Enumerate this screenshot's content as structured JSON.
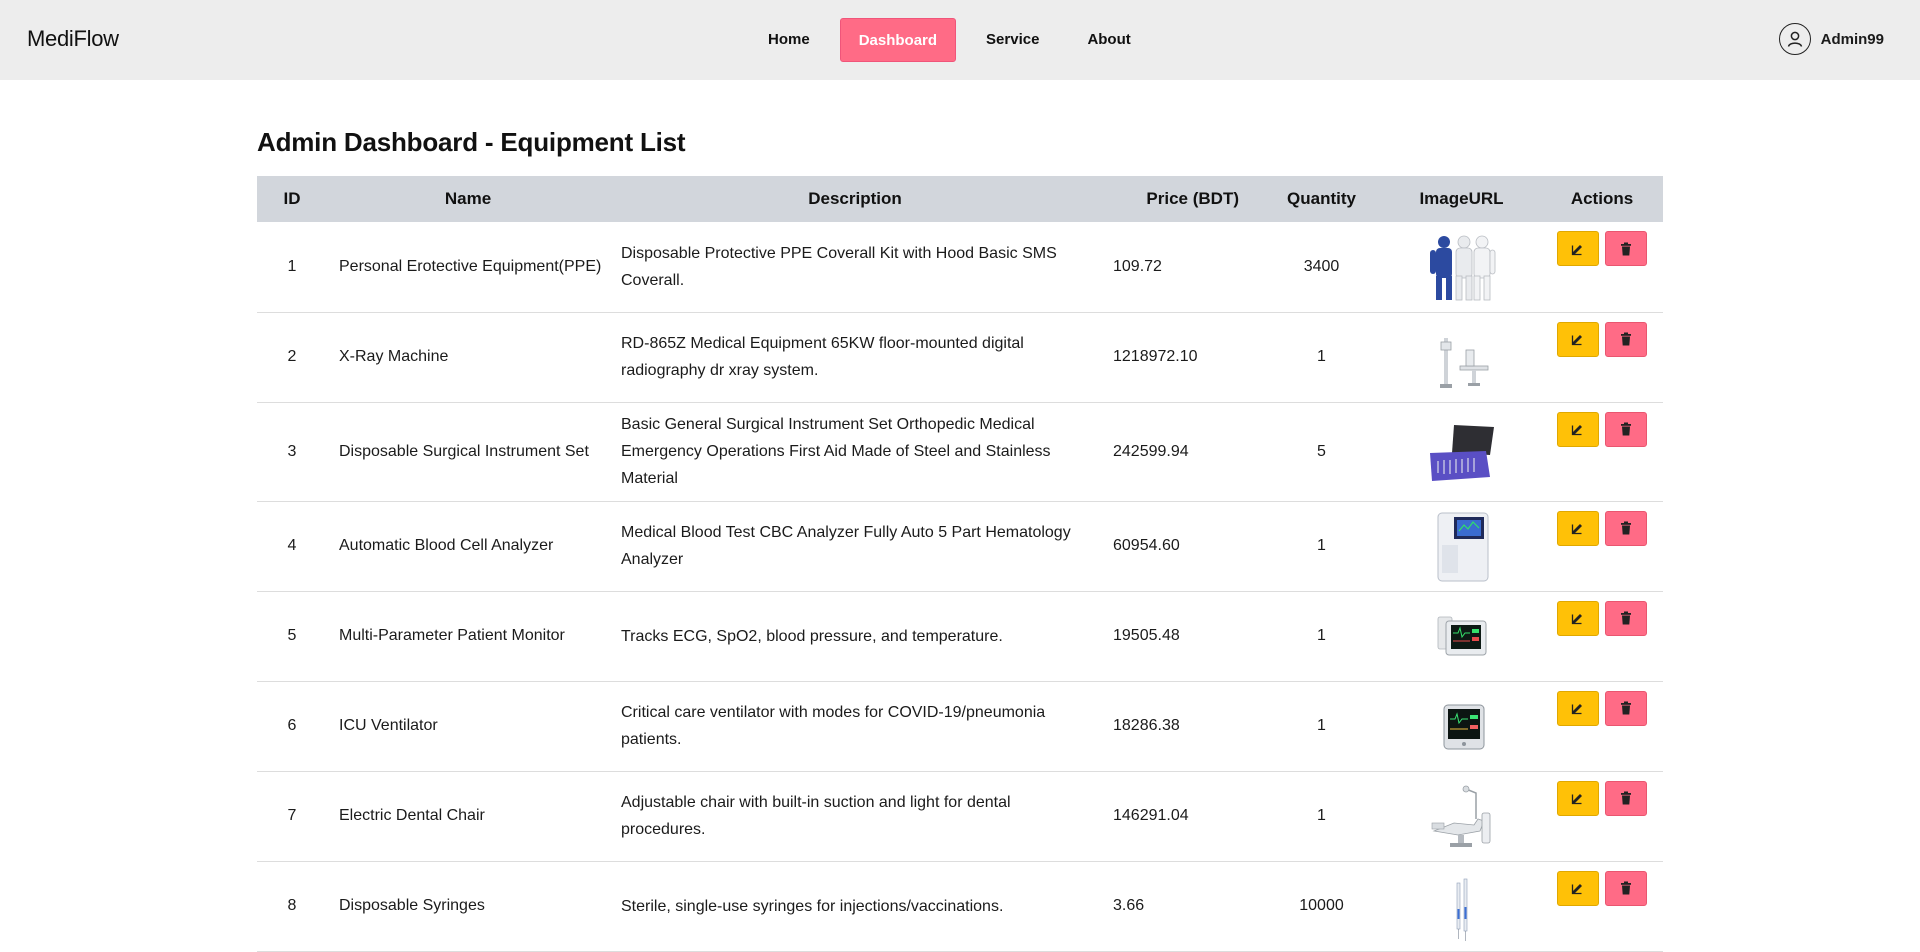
{
  "brand": "MediFlow",
  "nav": [
    {
      "label": "Home",
      "active": false
    },
    {
      "label": "Dashboard",
      "active": true
    },
    {
      "label": "Service",
      "active": false
    },
    {
      "label": "About",
      "active": false
    }
  ],
  "user": {
    "name": "Admin99",
    "icon": "user-circle-icon"
  },
  "page_title": "Admin Dashboard - Equipment List",
  "table": {
    "headers": [
      "ID",
      "Name",
      "Description",
      "Price (BDT)",
      "Quantity",
      "ImageURL",
      "Actions"
    ],
    "rows": [
      {
        "id": "1",
        "name": "Personal Erotective Equipment(PPE)",
        "description": "Disposable Protective PPE Coverall Kit with Hood Basic SMS Coverall.",
        "price": "109.72",
        "quantity": "3400",
        "image": "ppe-coverall-image"
      },
      {
        "id": "2",
        "name": "X-Ray Machine",
        "description": "RD-865Z Medical Equipment 65KW floor-mounted digital radiography dr xray system.",
        "price": "1218972.10",
        "quantity": "1",
        "image": "xray-machine-image"
      },
      {
        "id": "3",
        "name": "Disposable Surgical Instrument Set",
        "description": "Basic General Surgical Instrument Set Orthopedic Medical Emergency Operations First Aid Made of Steel and Stainless Material",
        "price": "242599.94",
        "quantity": "5",
        "image": "surgical-kit-image"
      },
      {
        "id": "4",
        "name": "Automatic Blood Cell Analyzer",
        "description": "Medical Blood Test CBC Analyzer Fully Auto 5 Part Hematology Analyzer",
        "price": "60954.60",
        "quantity": "1",
        "image": "blood-analyzer-image"
      },
      {
        "id": "5",
        "name": "Multi-Parameter Patient Monitor",
        "description": "Tracks ECG, SpO2, blood pressure, and temperature.",
        "price": "19505.48",
        "quantity": "1",
        "image": "patient-monitor-image"
      },
      {
        "id": "6",
        "name": "ICU Ventilator",
        "description": "Critical care ventilator with modes for COVID-19/pneumonia patients.",
        "price": "18286.38",
        "quantity": "1",
        "image": "ventilator-image"
      },
      {
        "id": "7",
        "name": "Electric Dental Chair",
        "description": "Adjustable chair with built-in suction and light for dental procedures.",
        "price": "146291.04",
        "quantity": "1",
        "image": "dental-chair-image"
      },
      {
        "id": "8",
        "name": "Disposable Syringes",
        "description": "Sterile, single-use syringes for injections/vaccinations.",
        "price": "3.66",
        "quantity": "10000",
        "image": "syringes-image"
      }
    ]
  },
  "actions": {
    "edit_icon": "edit-icon",
    "delete_icon": "trash-icon"
  },
  "colors": {
    "navbar_bg": "#ededed",
    "active_tab": "#ff6b86",
    "edit_btn": "#ffc107",
    "delete_btn": "#ff6b86",
    "table_header": "#d2d6dc"
  }
}
